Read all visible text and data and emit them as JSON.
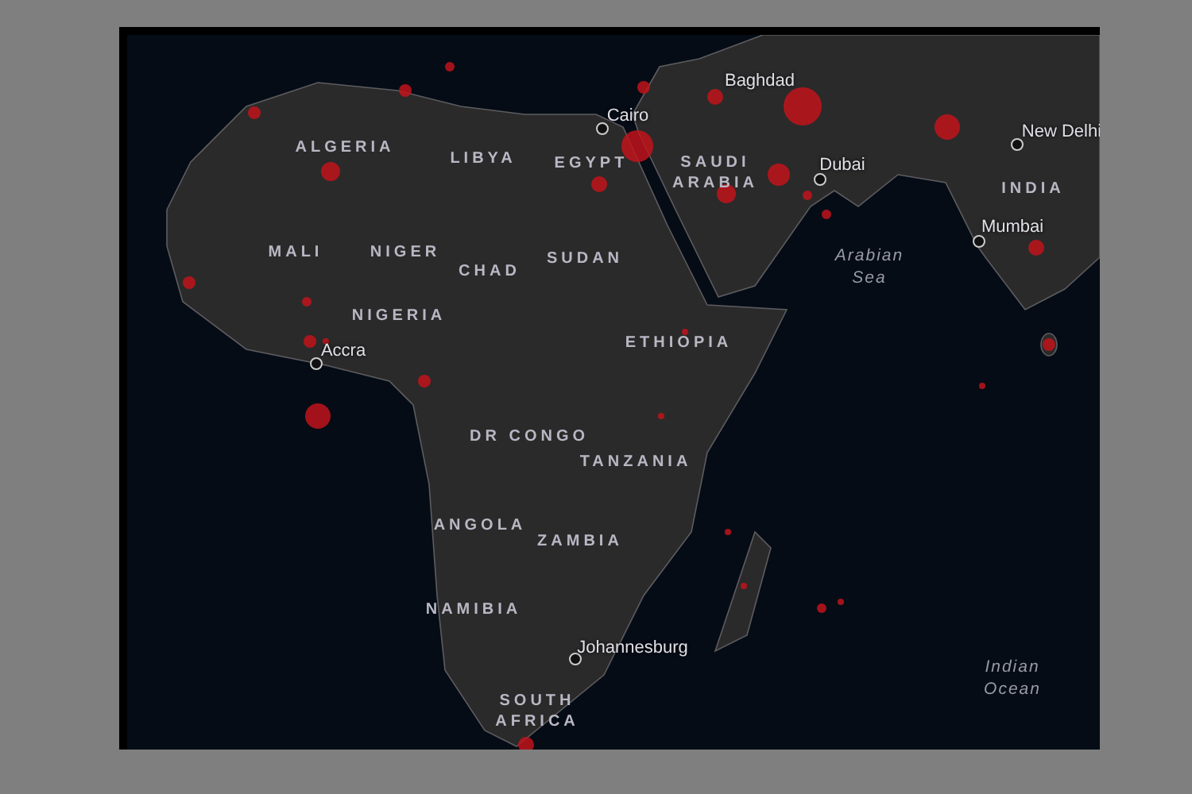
{
  "map": {
    "country_labels": [
      {
        "lines": [
          "ALGERIA"
        ]
      },
      {
        "lines": [
          "LIBYA"
        ]
      },
      {
        "lines": [
          "EGYPT"
        ]
      },
      {
        "lines": [
          "MALI"
        ]
      },
      {
        "lines": [
          "NIGER"
        ]
      },
      {
        "lines": [
          "CHAD"
        ]
      },
      {
        "lines": [
          "SUDAN"
        ]
      },
      {
        "lines": [
          "NIGERIA"
        ]
      },
      {
        "lines": [
          "SAUDI",
          "ARABIA"
        ]
      },
      {
        "lines": [
          "ETHIOPIA"
        ]
      },
      {
        "lines": [
          "DR CONGO"
        ]
      },
      {
        "lines": [
          "TANZANIA"
        ]
      },
      {
        "lines": [
          "ANGOLA"
        ]
      },
      {
        "lines": [
          "ZAMBIA"
        ]
      },
      {
        "lines": [
          "NAMIBIA"
        ]
      },
      {
        "lines": [
          "SOUTH",
          "AFRICA"
        ]
      },
      {
        "lines": [
          "INDIA"
        ]
      }
    ],
    "cities": [
      {
        "name": "Cairo"
      },
      {
        "name": "Baghdad"
      },
      {
        "name": "Dubai"
      },
      {
        "name": "New Delhi"
      },
      {
        "name": "Mumbai"
      },
      {
        "name": "Accra"
      },
      {
        "name": "Johannesburg"
      }
    ],
    "water_labels": [
      {
        "lines": [
          "Arabian",
          "Sea"
        ]
      },
      {
        "lines": [
          "Indian",
          "Ocean"
        ]
      }
    ]
  }
}
